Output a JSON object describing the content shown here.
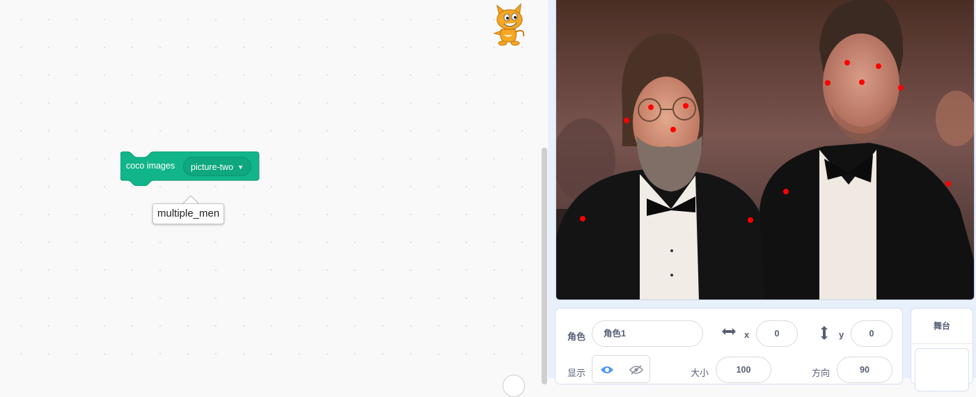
{
  "code_area": {
    "sprite_thumb_icon": "scratch-cat-icon",
    "block": {
      "label": "coco images",
      "dropdown_value": "picture-two",
      "color": "#12b58a"
    },
    "tooltip": "multiple_men"
  },
  "stage": {
    "image_icon": "two-men-photo",
    "keypoint_color": "#ff0000"
  },
  "sprite_info": {
    "sprite_label": "角色",
    "sprite_name": "角色1",
    "x_label": "x",
    "x_value": "0",
    "y_label": "y",
    "y_value": "0",
    "show_label": "显示",
    "size_label": "大小",
    "size_value": "100",
    "direction_label": "方向",
    "direction_value": "90"
  },
  "stage_panel": {
    "title": "舞台"
  }
}
